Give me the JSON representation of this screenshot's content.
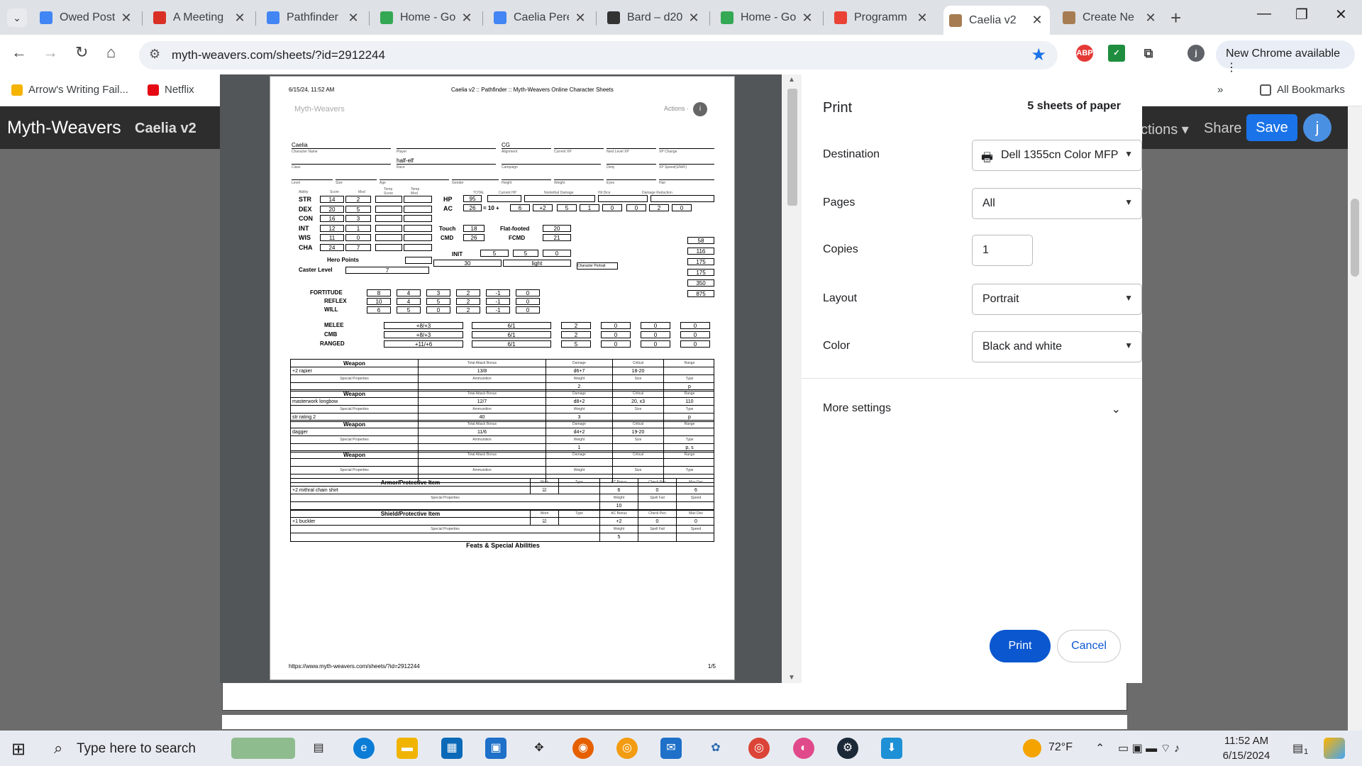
{
  "browser": {
    "tabs": [
      {
        "label": "Owed Post",
        "color": "#4285f4"
      },
      {
        "label": "A Meeting",
        "color": "#d93025"
      },
      {
        "label": "Pathfinder",
        "color": "#4285f4"
      },
      {
        "label": "Home - Go",
        "color": "#34a853"
      },
      {
        "label": "Caelia Pere",
        "color": "#4285f4"
      },
      {
        "label": "Bard – d20",
        "color": "#333333"
      },
      {
        "label": "Home - Go",
        "color": "#34a853"
      },
      {
        "label": "Programm",
        "color": "#ea4335"
      },
      {
        "label": "Caelia v2",
        "color": "#a67c52"
      },
      {
        "label": "Create Ne",
        "color": "#a67c52"
      }
    ],
    "url": "myth-weavers.com/sheets/?id=2912244",
    "new_chrome": "New Chrome available",
    "bookmarks": [
      {
        "label": "Arrow's Writing Fail...",
        "color": "#f4b400"
      },
      {
        "label": "Netflix",
        "color": "#e50914"
      }
    ],
    "all_bookmarks": "All Bookmarks"
  },
  "site": {
    "logo": "Myth-Weavers",
    "sheet_name": "Caelia v2",
    "actions": "ctions ▾",
    "share": "Share",
    "save": "Save",
    "avatar": "j"
  },
  "print_page": {
    "date": "6/15/24, 11:52 AM",
    "header_title": "Caelia v2 :: Pathfinder :: Myth-Weavers Online Character Sheets",
    "brand": "Myth-Weavers",
    "actions": "Actions ·",
    "char_name": "Caelia",
    "alignment": "CG",
    "race": "half-elf",
    "labels_row1": [
      "Character Name",
      "Player",
      "Alignment",
      "Current XP",
      "Next Level XP",
      "XP Change"
    ],
    "labels_row2": [
      "Class",
      "Race",
      "Campaign",
      "Deity",
      "XP Speed(S/M/F)"
    ],
    "labels_row3": [
      "Level",
      "Size",
      "Age",
      "Gender",
      "Height",
      "Weight",
      "Eyes",
      "Hair"
    ],
    "abilities": [
      {
        "abbr": "STR",
        "score": "14",
        "mod": "2"
      },
      {
        "abbr": "DEX",
        "score": "20",
        "mod": "5"
      },
      {
        "abbr": "CON",
        "score": "16",
        "mod": "3"
      },
      {
        "abbr": "INT",
        "score": "12",
        "mod": "1"
      },
      {
        "abbr": "WIS",
        "score": "11",
        "mod": "0"
      },
      {
        "abbr": "CHA",
        "score": "24",
        "mod": "7"
      }
    ],
    "hp": "95",
    "ac": "26",
    "ac_parts": [
      "6",
      "+2",
      "5",
      "1",
      "0",
      "0",
      "2",
      "0"
    ],
    "touch": "18",
    "flat_footed": "20",
    "cmd": "26",
    "fcmd": "21",
    "init": "5",
    "init_parts": [
      "5",
      "0"
    ],
    "hero_points": "Hero Points",
    "caster_level_label": "Caster Level",
    "caster_level": "7",
    "speed": "30",
    "armor_type": "light",
    "portrait": "Character Portrait",
    "loads": [
      "58",
      "116",
      "175",
      "175",
      "350",
      "875"
    ],
    "saves": [
      {
        "name": "FORTITUDE",
        "vals": [
          "8",
          "4",
          "3",
          "2",
          "-1",
          "0"
        ]
      },
      {
        "name": "REFLEX",
        "vals": [
          "10",
          "4",
          "5",
          "2",
          "-1",
          "0"
        ]
      },
      {
        "name": "WILL",
        "vals": [
          "6",
          "5",
          "0",
          "2",
          "-1",
          "0"
        ]
      }
    ],
    "attacks": [
      {
        "name": "MELEE",
        "total": "+8/+3",
        "base": "6/1",
        "mods": [
          "2",
          "0",
          "0",
          "0"
        ]
      },
      {
        "name": "CMB",
        "total": "+8/+3",
        "base": "6/1",
        "mods": [
          "2",
          "0",
          "0",
          "0"
        ]
      },
      {
        "name": "RANGED",
        "total": "+11/+6",
        "base": "6/1",
        "mods": [
          "5",
          "0",
          "0",
          "0"
        ]
      }
    ],
    "weapons": [
      {
        "name": "+2 rapier",
        "attack": "13/8",
        "damage": "d6+7",
        "critical": "18-20",
        "range": "",
        "ammo": "",
        "weight": "2",
        "size": "",
        "type": "p",
        "notes": ""
      },
      {
        "name": "masterwork longbow",
        "attack": "12/7",
        "damage": "d8+2",
        "critical": "20, x3",
        "range": "110",
        "ammo": "40",
        "weight": "3",
        "size": "",
        "type": "p",
        "notes": "str rating 2"
      },
      {
        "name": "dagger",
        "attack": "11/6",
        "damage": "d4+2",
        "critical": "19-20",
        "range": "",
        "ammo": "",
        "weight": "1",
        "size": "",
        "type": "p, s",
        "notes": ""
      },
      {
        "name": "",
        "attack": "",
        "damage": "",
        "critical": "",
        "range": "",
        "ammo": "",
        "weight": "",
        "size": "",
        "type": "",
        "notes": ""
      }
    ],
    "armor": {
      "name": "+2 mithral chain shirt",
      "bonus": "6",
      "check": "0",
      "maxdex": "6",
      "weight": "10"
    },
    "shield": {
      "name": "+1 buckler",
      "bonus": "+2",
      "check": "0",
      "maxdex": "0",
      "weight": "5"
    },
    "feats_title": "Feats & Special Abilities",
    "footer_url": "https://www.myth-weavers.com/sheets/?id=2912244",
    "footer_page": "1/5"
  },
  "print_dialog": {
    "title": "Print",
    "sheets": "5 sheets of paper",
    "destination_label": "Destination",
    "destination": "Dell 1355cn Color MFP",
    "pages_label": "Pages",
    "pages": "All",
    "copies_label": "Copies",
    "copies": "1",
    "layout_label": "Layout",
    "layout": "Portrait",
    "color_label": "Color",
    "color": "Black and white",
    "more_settings": "More settings",
    "print_button": "Print",
    "cancel_button": "Cancel"
  },
  "taskbar": {
    "search_placeholder": "Type here to search",
    "weather": "72°F",
    "time": "11:52 AM",
    "date": "6/15/2024",
    "notifications": "1"
  }
}
